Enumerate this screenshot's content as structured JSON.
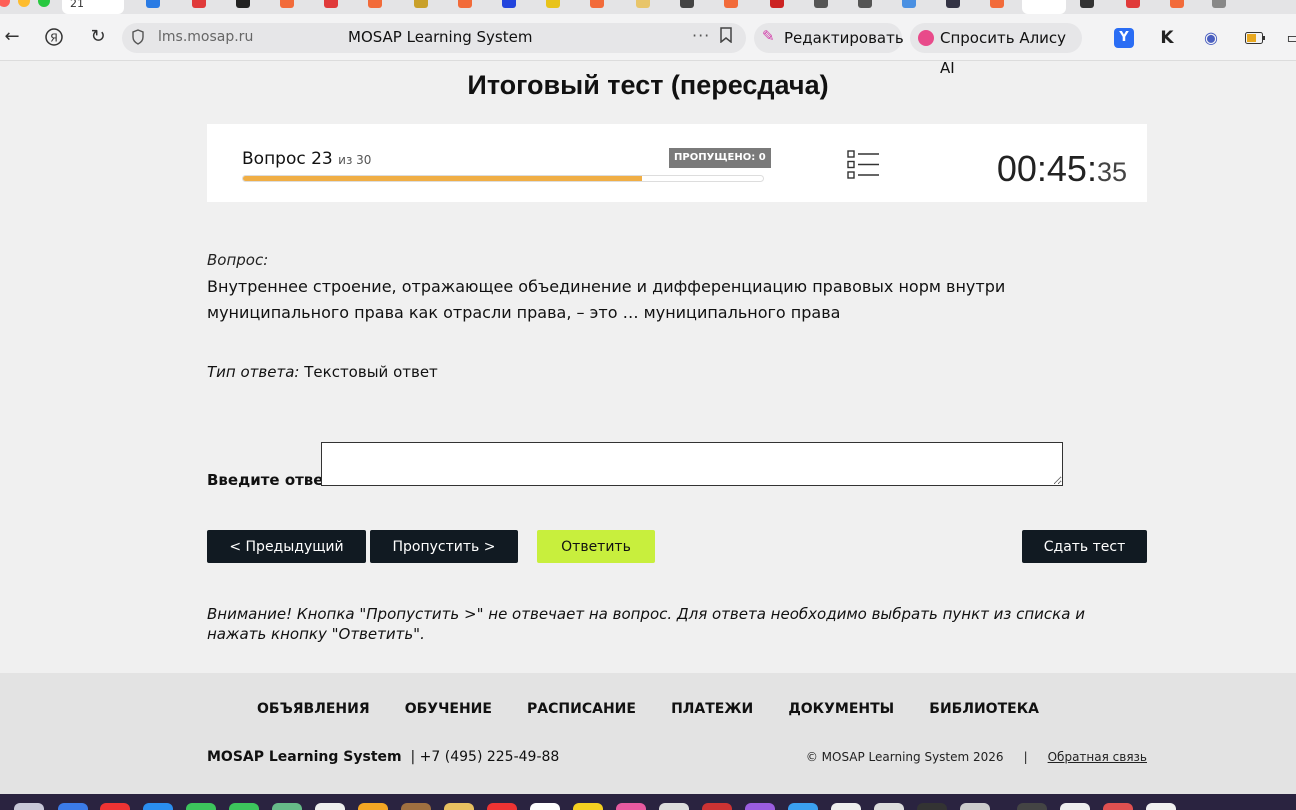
{
  "browser": {
    "address_host": "lms.mosap.ru",
    "page_title": "MOSAP Learning System",
    "edit_label": "Редактировать",
    "alice_label": "Спросить Алису AI",
    "tab_number": "21",
    "colors": {
      "toolbar": "#f3f3f4",
      "addressbar": "#e6e6e8"
    }
  },
  "test": {
    "title": "Итоговый тест (пересдача)",
    "question_label": "Вопрос 23",
    "question_of": "из 30",
    "progress_fraction": 0.7667,
    "skipped_badge": "ПРОПУЩЕНО: 0",
    "timer_main": "00:45:",
    "timer_seconds": "35",
    "list_icon": "list-icon"
  },
  "question": {
    "label": "Вопрос:",
    "text": "Внутреннее строение, отражающее объединение и дифференциацию правовых норм внутри муниципального права как отрасли права, – это … муниципального права",
    "answer_type_label": "Тип ответа:",
    "answer_type_value": "Текстовый ответ",
    "input_label": "Введите ответ:",
    "input_value": ""
  },
  "buttons": {
    "prev": "< Предыдущий",
    "skip": "Пропустить >",
    "answer": "Ответить",
    "submit": "Сдать тест"
  },
  "warning": "Внимание! Кнопка \"Пропустить >\" не отвечает на вопрос. Для ответа необходимо выбрать пункт из списка и нажать кнопку \"Ответить\".",
  "footer": {
    "nav": [
      "ОБЪЯВЛЕНИЯ",
      "ОБУЧЕНИЕ",
      "РАСПИСАНИЕ",
      "ПЛАТЕЖИ",
      "ДОКУМЕНТЫ",
      "БИБЛИОТЕКА"
    ],
    "brand": "MOSAP Learning System",
    "phone": "| +7 (495) 225-49-88",
    "copyright": "© MOSAP Learning System 2026",
    "separator": "|",
    "feedback": "Обратная связь"
  },
  "colors": {
    "accent_progress": "#f0ae45",
    "answer_button": "#c8ef3d",
    "dark_button": "#111a22",
    "page_bg": "#f0f0f0",
    "footer_bg": "#e3e3e3"
  }
}
